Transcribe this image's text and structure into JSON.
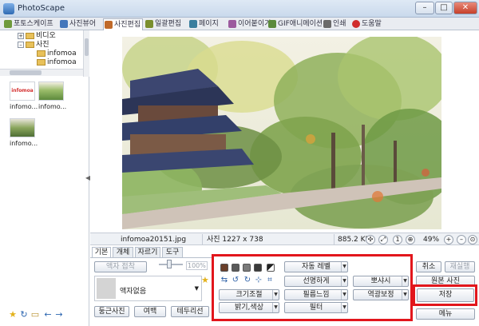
{
  "window": {
    "title": "PhotoScape",
    "min": "–",
    "max": "□",
    "close": "✕"
  },
  "tabs": [
    {
      "label": "포토스케이프",
      "color": "#6f9a3c"
    },
    {
      "label": "사진뷰어",
      "color": "#4477bb"
    },
    {
      "label": "사진편집",
      "color": "#c06a2a"
    },
    {
      "label": "일괄편집",
      "color": "#7a8f2e"
    },
    {
      "label": "페이지",
      "color": "#3a7e9e"
    },
    {
      "label": "이어붙이기",
      "color": "#9c5a9e"
    },
    {
      "label": "GIF애니메이션",
      "color": "#5b8a3b"
    },
    {
      "label": "인쇄",
      "color": "#6a6a6a"
    },
    {
      "label": "도움말",
      "color": "#d02c2c"
    }
  ],
  "tree": {
    "items": [
      {
        "label": "비디오",
        "exp": "+"
      },
      {
        "label": "사진",
        "exp": "–"
      },
      {
        "label": "infomoa"
      },
      {
        "label": "infomoa"
      }
    ]
  },
  "thumbnails": [
    {
      "label": "infomo...",
      "logo": "infomoa"
    },
    {
      "label": "infomo..."
    },
    {
      "label": "infomo..."
    }
  ],
  "status": {
    "filename": "infomoa20151.jpg",
    "dims": "사진 1227 x 738",
    "filesize": "885.2 KB",
    "zoom": "49%"
  },
  "edit_tabs": [
    "기본",
    "개체",
    "자르기",
    "도구"
  ],
  "basic": {
    "frame_merge": "액자 접착",
    "percent": "100%",
    "frame_name": "액자없음",
    "round_photo": "둥근사진",
    "margin": "여백",
    "border": "테두리선"
  },
  "tools": {
    "auto_level": "자동 레벨",
    "resize": "크기조절",
    "sharpen": "선명하게",
    "bright_color": "밝기,색상",
    "film_effect": "필름느낌",
    "filter": "필터",
    "bloom": "뽀샤시",
    "backlight": "역광보정"
  },
  "right_buttons": {
    "cancel": "취소",
    "redo": "재실행",
    "original": "원본 사진",
    "save": "저장",
    "menu": "메뉴"
  },
  "colors": {
    "highlight": "#e2161c",
    "window_bg": "#ffffff"
  }
}
